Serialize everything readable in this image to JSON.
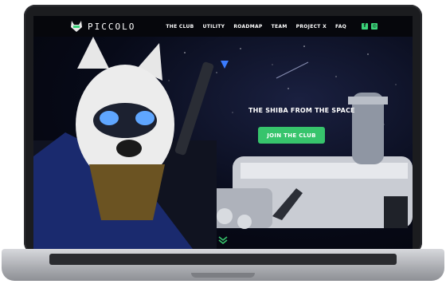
{
  "brand": {
    "name": "PICCOLO"
  },
  "nav": {
    "items": [
      {
        "label": "THE CLUB"
      },
      {
        "label": "UTILITY"
      },
      {
        "label": "ROADMAP"
      },
      {
        "label": "TEAM"
      },
      {
        "label": "PROJECT X"
      },
      {
        "label": "FAQ"
      }
    ],
    "social": [
      {
        "icon": "facebook-icon",
        "glyph": "f"
      },
      {
        "icon": "instagram-icon",
        "glyph": "◎"
      }
    ]
  },
  "hero": {
    "tagline": "THE SHIBA FROM THE SPACE",
    "cta_label": "JOIN THE CLUB"
  },
  "colors": {
    "accent": "#37c46c",
    "background": "#050814"
  }
}
